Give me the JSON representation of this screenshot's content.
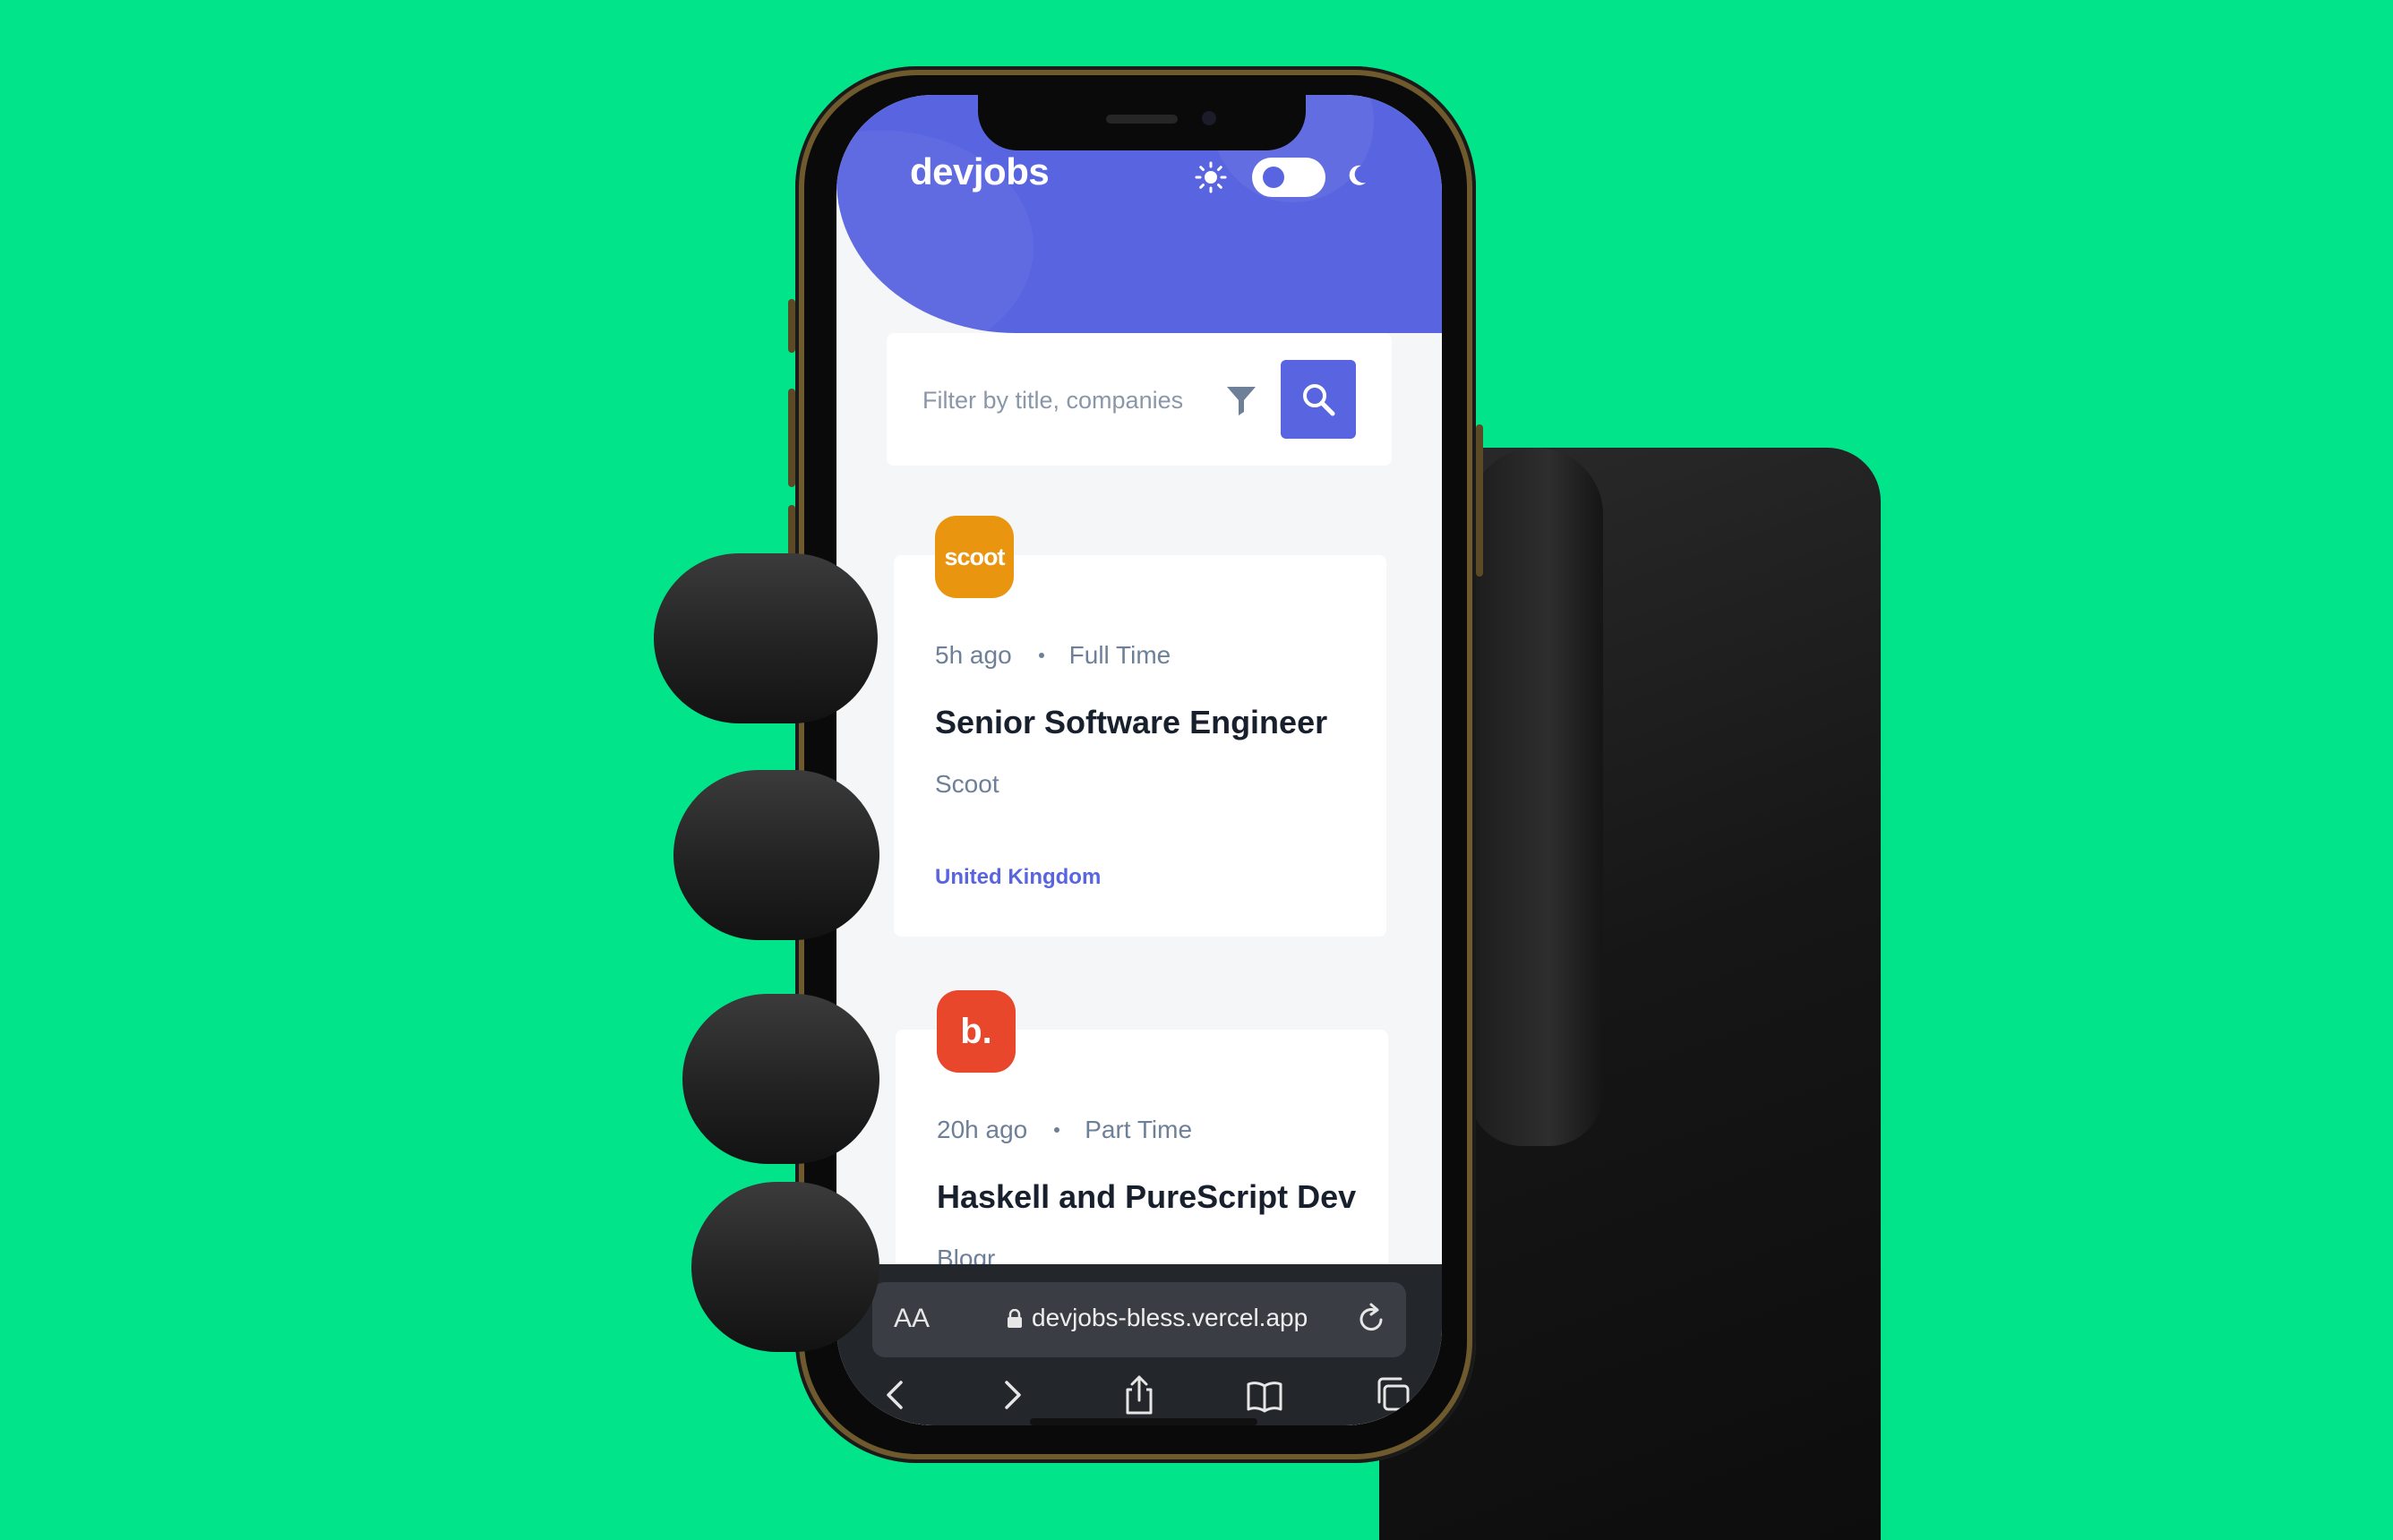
{
  "app": {
    "logo": "devjobs",
    "theme_toggle": {
      "light_icon": "sun-icon",
      "dark_icon": "moon-icon",
      "state": "light"
    }
  },
  "search": {
    "placeholder": "Filter by title, companies",
    "filter_icon": "filter-icon",
    "search_icon": "search-icon"
  },
  "jobs": [
    {
      "logo_text": "scoot",
      "logo_color": "#e9950f",
      "posted": "5h ago",
      "contract": "Full Time",
      "title": "Senior Software Engineer",
      "company": "Scoot",
      "location": "United Kingdom"
    },
    {
      "logo_text": "b.",
      "logo_color": "#e8472c",
      "posted": "20h ago",
      "contract": "Part Time",
      "title": "Haskell and PureScript Dev",
      "company": "Blogr"
    }
  ],
  "browser": {
    "text_size_label": "AA",
    "url": "devjobs-bless.vercel.app",
    "toolbar": [
      "back-icon",
      "forward-icon",
      "share-icon",
      "bookmarks-icon",
      "tabs-icon"
    ]
  },
  "colors": {
    "background": "#02e48a",
    "brand": "#5964e0",
    "title_text": "#19202d",
    "muted_text": "#6e8098"
  }
}
